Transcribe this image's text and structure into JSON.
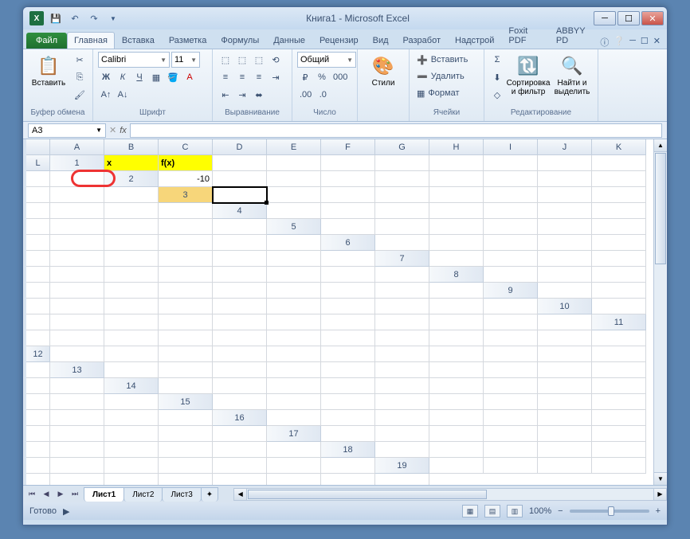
{
  "window": {
    "title": "Книга1  -  Microsoft Excel"
  },
  "qat": {
    "save": "save",
    "undo": "undo",
    "redo": "redo"
  },
  "tabs": {
    "file": "Файл",
    "home": "Главная",
    "insert": "Вставка",
    "layout": "Разметка",
    "formulas": "Формулы",
    "data": "Данные",
    "review": "Рецензир",
    "view": "Вид",
    "developer": "Разработ",
    "addins": "Надстрой",
    "foxit": "Foxit PDF",
    "abbyy": "ABBYY PD"
  },
  "ribbon": {
    "clipboard": {
      "paste": "Вставить",
      "label": "Буфер обмена"
    },
    "font": {
      "name": "Calibri",
      "size": "11",
      "label": "Шрифт",
      "bold": "Ж",
      "italic": "К",
      "underline": "Ч"
    },
    "align": {
      "label": "Выравнивание"
    },
    "number": {
      "format": "Общий",
      "label": "Число"
    },
    "styles": {
      "btn": "Стили"
    },
    "cells": {
      "insert": "Вставить",
      "delete": "Удалить",
      "format": "Формат",
      "label": "Ячейки"
    },
    "editing": {
      "sort": "Сортировка\nи фильтр",
      "find": "Найти и\nвыделить",
      "label": "Редактирование"
    }
  },
  "namebox": "A3",
  "columns": [
    "A",
    "B",
    "C",
    "D",
    "E",
    "F",
    "G",
    "H",
    "I",
    "J",
    "K",
    "L"
  ],
  "rows": [
    "1",
    "2",
    "3",
    "4",
    "5",
    "6",
    "7",
    "8",
    "9",
    "10",
    "11",
    "12",
    "13",
    "14",
    "15",
    "16",
    "17",
    "18",
    "19"
  ],
  "cells": {
    "A1": "x",
    "B1": "f(x)",
    "A2": "-10"
  },
  "sheets": {
    "s1": "Лист1",
    "s2": "Лист2",
    "s3": "Лист3"
  },
  "status": {
    "ready": "Готово",
    "zoom": "100%"
  }
}
